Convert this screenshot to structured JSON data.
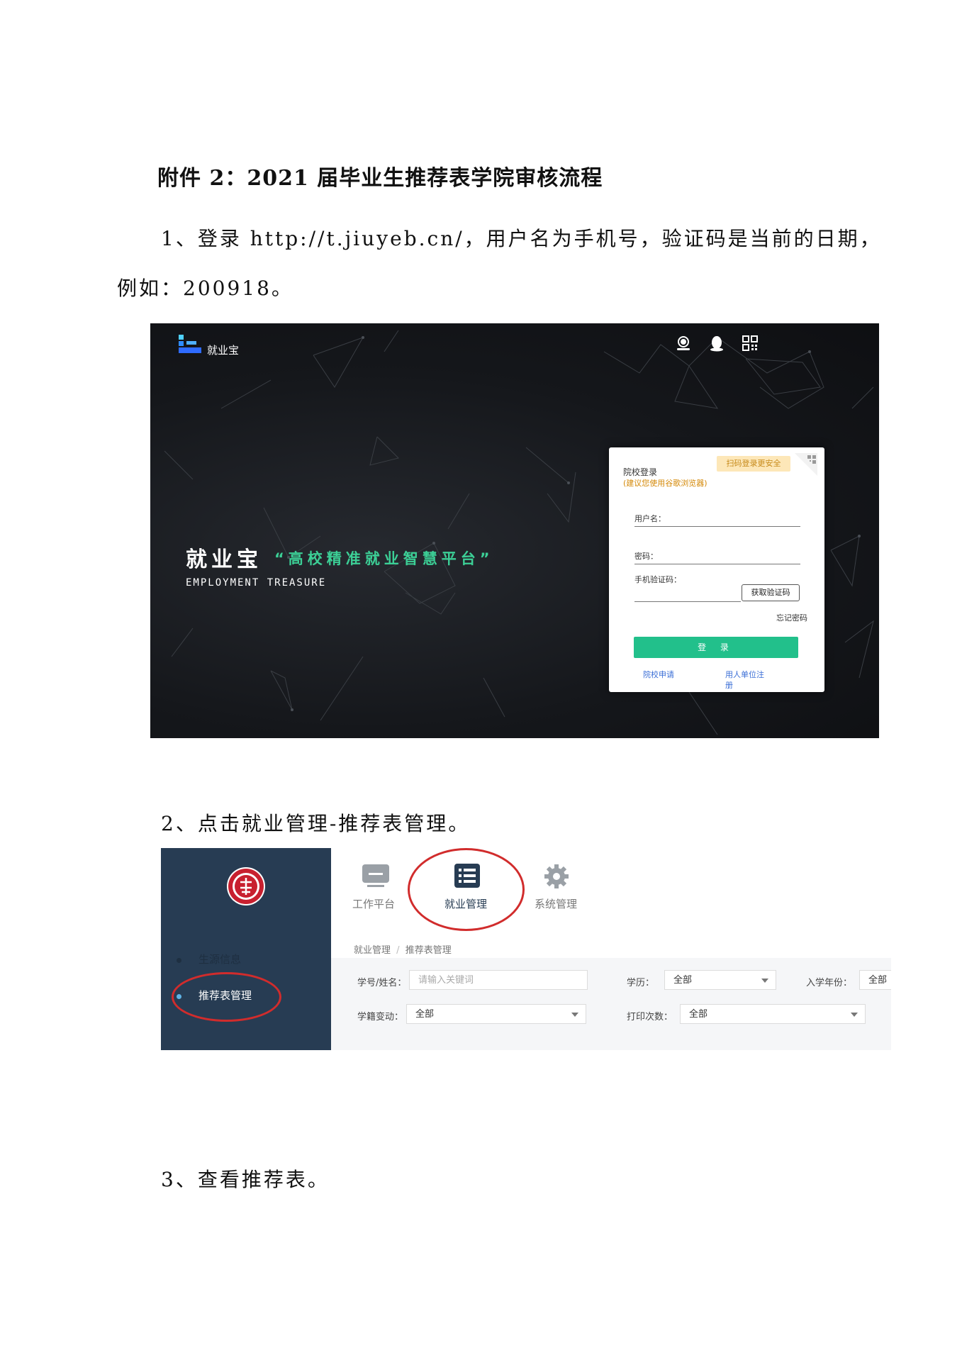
{
  "document": {
    "title": "附件 2：2021 届毕业生推荐表学院审核流程",
    "step1_line1": "1、登录 http://t.jiuyeb.cn/，用户名为手机号，验证码是当前的日期，",
    "step1_line2": "例如：200918。",
    "step2": "2、点击就业管理-推荐表管理。",
    "step3": "3、查看推荐表。"
  },
  "login_screenshot": {
    "brand_small": "就业宝",
    "hero_title": "就业宝",
    "hero_slogan": "“高校精准就业智慧平台”",
    "hero_en": "EMPLOYMENT TREASURE",
    "icons": [
      "service-icon",
      "qq-icon",
      "qrcode-icon"
    ],
    "card": {
      "title": "院校登录",
      "hint": "(建议您使用谷歌浏览器)",
      "scan_badge": "扫码登录更安全",
      "username_label": "用户名：",
      "password_label": "密码：",
      "sms_label": "手机验证码：",
      "sms_button": "获取验证码",
      "forgot": "忘记密码",
      "login_button": "登 录",
      "link_apply": "院校申请",
      "link_register_1": "用人单位注",
      "link_register_2": "册"
    },
    "colors": {
      "accent": "#22c08b",
      "slogan": "#3ccf96",
      "hint": "#d48806"
    }
  },
  "nav_screenshot": {
    "top_menu": [
      {
        "label": "工作平台",
        "icon": "monitor-icon"
      },
      {
        "label": "就业管理",
        "icon": "list-icon"
      },
      {
        "label": "系统管理",
        "icon": "gear-icon"
      }
    ],
    "sidebar": [
      {
        "label": "生源信息",
        "active": false
      },
      {
        "label": "推荐表管理",
        "active": true
      }
    ],
    "breadcrumb": {
      "part1": "就业管理",
      "separator": "/",
      "part2": "推荐表管理"
    },
    "filters": {
      "id_name_label": "学号/姓名：",
      "id_name_placeholder": "请输入关键词",
      "degree_label": "学历：",
      "degree_value": "全部",
      "year_label": "入学年份：",
      "year_value": "全部",
      "status_label": "学籍变动：",
      "status_value": "全部",
      "print_label": "打印次数：",
      "print_value": "全部"
    },
    "colors": {
      "sidebar": "#273c53",
      "highlight": "#d12c2c"
    }
  }
}
